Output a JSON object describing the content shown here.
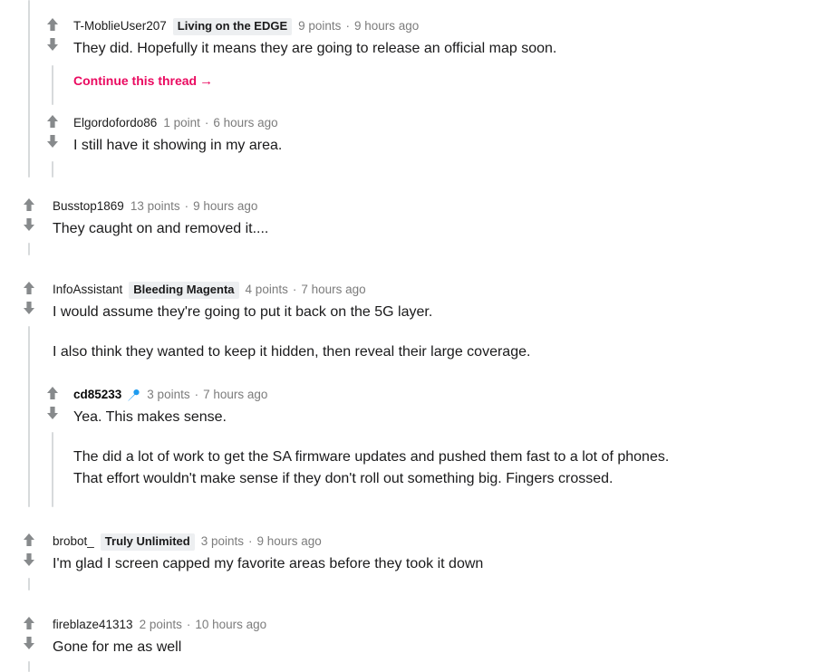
{
  "theme": {
    "link_color": "#ea0a60",
    "text_color": "#1a1a1b",
    "meta_color": "#7c7c7c",
    "flair_bg": "#edeff1",
    "arrow_color": "#878a8c",
    "threadline_color": "#d7dadc",
    "op_icon_color": "#0079d3"
  },
  "separator": "·",
  "comments": [
    {
      "id": "c1",
      "user": "T-MoblieUser207",
      "flair": "Living on the EDGE",
      "points": "9 points",
      "time": "9 hours ago",
      "text": "They did. Hopefully it means they are going to release an official map soon.",
      "continue_label": "Continue this thread",
      "continue_arrow": "→"
    },
    {
      "id": "c2",
      "user": "Elgordofordo86",
      "points": "1 point",
      "time": "6 hours ago",
      "text": "I still have it showing in my area."
    },
    {
      "id": "c3",
      "user": "Busstop1869",
      "points": "13 points",
      "time": "9 hours ago",
      "text": "They caught on and removed it...."
    },
    {
      "id": "c4",
      "user": "InfoAssistant",
      "flair": "Bleeding Magenta",
      "points": "4 points",
      "time": "7 hours ago",
      "text_p1": "I would assume they're going to put it back on the 5G layer.",
      "text_p2": "I also think they wanted to keep it hidden, then reveal their large coverage."
    },
    {
      "id": "c5",
      "user": "cd85233",
      "op_icon": "microphone-icon",
      "points": "3 points",
      "time": "7 hours ago",
      "text_p1": "Yea. This makes sense.",
      "text_p2_line1": "The did a lot of work to get the SA firmware updates and pushed them fast to a lot of phones.",
      "text_p2_line2": "That effort wouldn't make sense if they don't roll out something big. Fingers crossed."
    },
    {
      "id": "c6",
      "user": "brobot_",
      "flair": "Truly Unlimited",
      "points": "3 points",
      "time": "9 hours ago",
      "text": "I'm glad I screen capped my favorite areas before they took it down"
    },
    {
      "id": "c7",
      "user": "fireblaze41313",
      "points": "2 points",
      "time": "10 hours ago",
      "text": "Gone for me as well"
    }
  ]
}
